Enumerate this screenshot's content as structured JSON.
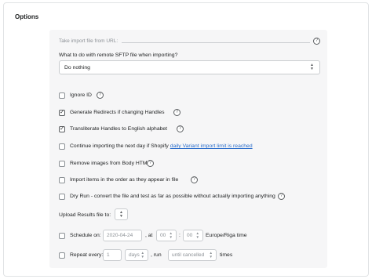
{
  "section_title": "Options",
  "url_label": "Take import file from URL:",
  "sftp": {
    "label": "What to do with remote SFTP file when importing?",
    "value": "Do nothing"
  },
  "options": [
    {
      "label": "Ignore ID",
      "checked": false,
      "help": true
    },
    {
      "label": "Generate Redirects if changing Handles",
      "checked": true,
      "help": true
    },
    {
      "label": "Transliterate Handles to English alphabet",
      "checked": true,
      "help": true
    },
    {
      "label": "Continue importing the next day if Shopify ",
      "link": "daily Variant import limit is reached",
      "checked": false,
      "help": false
    },
    {
      "label": "Remove images from Body HTML",
      "checked": false,
      "help": true
    },
    {
      "label": "Import items in the order as they appear in file",
      "checked": false,
      "help": true
    },
    {
      "label": "Dry Run - convert the file and test as far as possible without actually importing anything",
      "checked": false,
      "help": true
    }
  ],
  "upload": {
    "label": "Upload Results file to:"
  },
  "schedule": {
    "label": "Schedule on:",
    "date": "2020-04-24",
    "at": ", at",
    "hour": "00",
    "colon": ":",
    "minute": "00",
    "timezone": "Europe/Riga time"
  },
  "repeat": {
    "label": "Repeat every:",
    "count": "1",
    "unit": "days",
    "run": ", run",
    "until": "until cancelled",
    "times": "times"
  },
  "icons": {
    "help": "?",
    "check": "✓",
    "chevron_up": "▲",
    "chevron_down": "▼"
  }
}
